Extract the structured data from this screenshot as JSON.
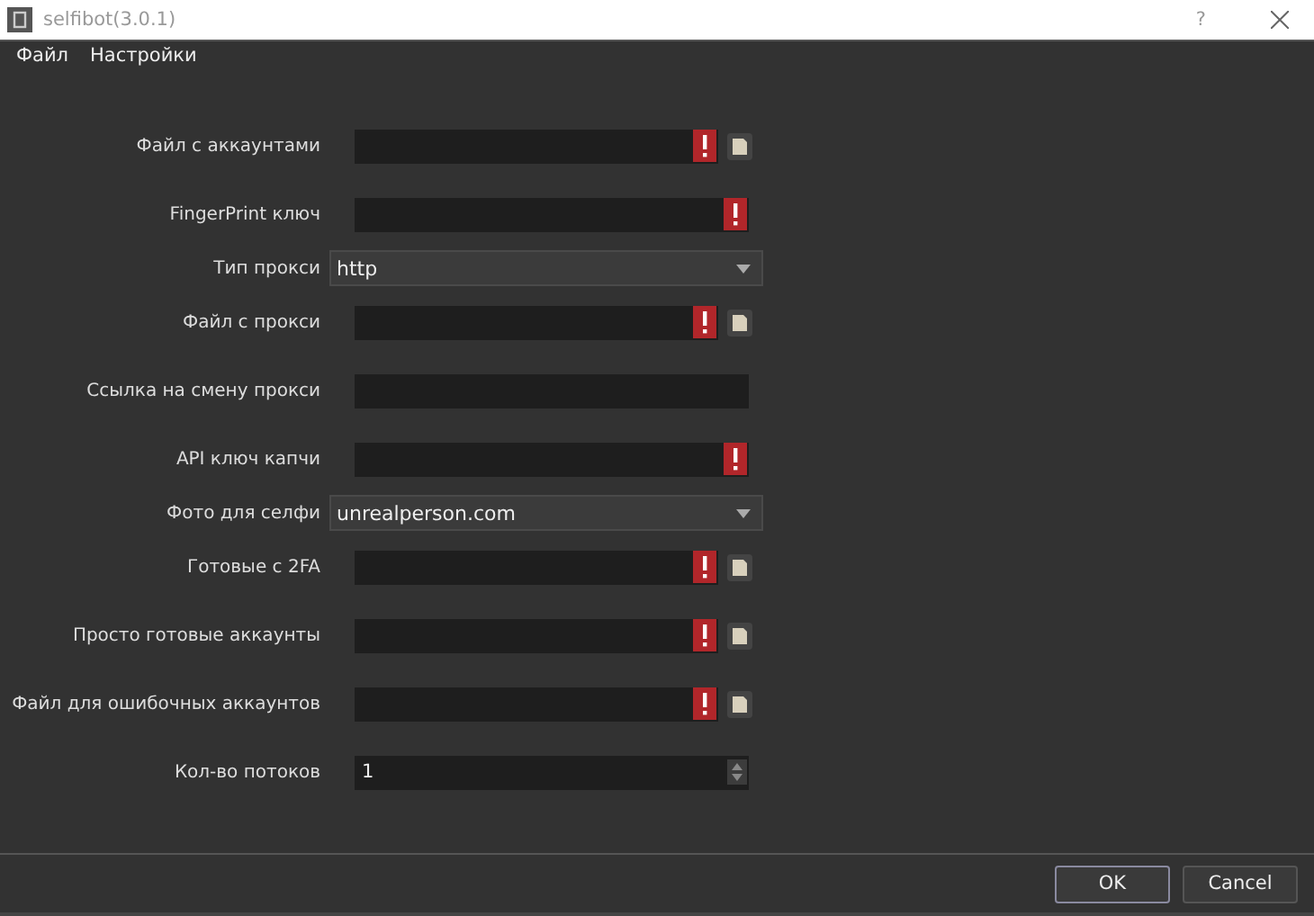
{
  "window": {
    "title": "selfibot(3.0.1)",
    "help": "?"
  },
  "menu": [
    "Файл",
    "Настройки"
  ],
  "fields": [
    {
      "kind": "file",
      "label": "Файл с аккаунтами",
      "error": true
    },
    {
      "kind": "key",
      "label": "FingerPrint ключ",
      "error": true
    },
    {
      "kind": "select",
      "label": "Тип прокси",
      "value": "http"
    },
    {
      "kind": "file",
      "label": "Файл с прокси",
      "error": true
    },
    {
      "kind": "text",
      "label": "Ссылка на смену прокси",
      "error": false
    },
    {
      "kind": "key",
      "label": "API ключ капчи",
      "error": true
    },
    {
      "kind": "select",
      "label": "Фото для селфи",
      "value": "unrealperson.com"
    },
    {
      "kind": "file",
      "label": "Готовые с 2FA",
      "error": true
    },
    {
      "kind": "file",
      "label": "Просто готовые аккаунты",
      "error": true
    },
    {
      "kind": "file",
      "label": "Файл для ошибочных аккаунтов",
      "error": true
    },
    {
      "kind": "spin",
      "label": "Кол-во потоков",
      "value": "1"
    }
  ],
  "buttons": [
    {
      "label": "OK",
      "default": true
    },
    {
      "label": "Cancel",
      "default": false
    }
  ]
}
